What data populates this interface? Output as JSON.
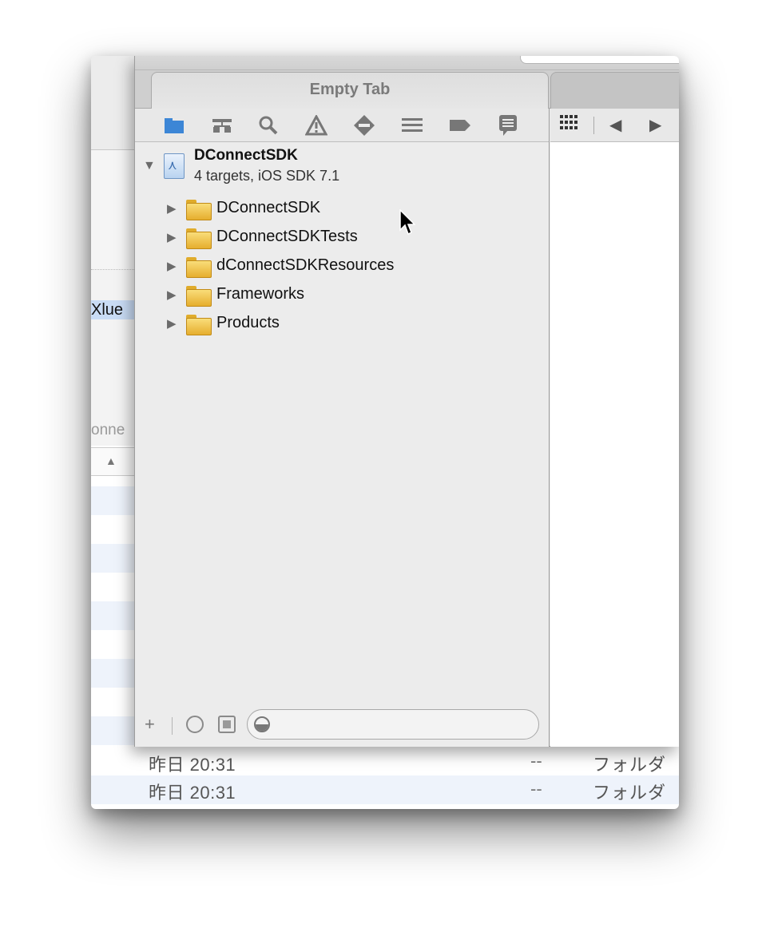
{
  "xcode": {
    "tab_label": "Empty Tab",
    "project": {
      "name": "DConnectSDK",
      "subtitle": "4 targets, iOS SDK 7.1"
    },
    "groups": [
      {
        "label": "DConnectSDK"
      },
      {
        "label": "DConnectSDKTests"
      },
      {
        "label": "dConnectSDKResources"
      },
      {
        "label": "Frameworks"
      },
      {
        "label": "Products"
      }
    ],
    "navigator_icons": [
      "folder-icon",
      "hierarchy-icon",
      "magnifier-icon",
      "warning-icon",
      "breakpoint-diamond-icon",
      "debug-list-icon",
      "tag-icon",
      "log-bubble-icon"
    ],
    "filter": {
      "placeholder": ""
    }
  },
  "finder_background": {
    "popup_label": "Xlue",
    "column_fragment": "onne",
    "rows": [
      {
        "date": "昨日 20:31",
        "size": "--",
        "kind": "フォルダ"
      },
      {
        "date": "昨日 20:31",
        "size": "--",
        "kind": "フォルダ"
      }
    ]
  },
  "colors": {
    "selected_icon": "#3c86d6",
    "row_alternate": "#eef3fb",
    "folder": "#e6ae2e"
  }
}
